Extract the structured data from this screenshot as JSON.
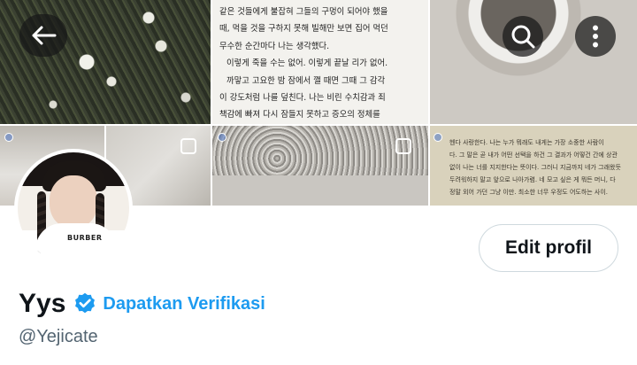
{
  "banner": {
    "book_page_lines": [
      "같은 것들에게 불잡혀 그들의 구멍이 되어야 했을",
      "때, 먹을 것을 구하지 못해 빌해만 보면 집어 먹던",
      "무수한 순간마다 나는 생각했다.",
      "이렇게 죽을 수는 없어. 이렇게 끝날 리가 없어.",
      "까맣고 고요한 밤 잠에서 깰 때면 그때 그 감각",
      "이 강도처럼 나를 덮친다. 나는 비린 수치감과 죄",
      "책감에 빠져 다시 잠들지 못하고 증오의 정체를"
    ],
    "book_page2_lines": [
      "헨다 사랑한다. 나는 누가 뭐래도 내게는 가장 소중한 사람이",
      "다. 그 말은 곧 내가 어떤 선택을 하건 그 결과가 어떻건 간에 상관",
      "없이 나는 너를 지지한다는 뜻이다. 그러니 지금까지 네가 그래왔듯",
      "두려워하지 말고 앞으로 나아가렴. 네 모고 싶은 게 뭐든 머니, 다",
      "정말 외어 가던 그냥 이만. 최소한 너무 우정도 어도하는 사이."
    ]
  },
  "nav": {
    "back_icon": "arrow-left-icon",
    "search_icon": "search-icon",
    "more_icon": "more-vertical-icon"
  },
  "profile": {
    "avatar_logo_text": "BURBER",
    "display_name": "Yys",
    "verified_icon": "verified-badge-icon",
    "get_verified_label": "Dapatkan Verifikasi",
    "handle": "@Yejicate",
    "edit_button_label": "Edit profil"
  },
  "colors": {
    "accent": "#1d9bf0",
    "text_primary": "#0f1419",
    "text_secondary": "#536471",
    "button_border": "#cfd9de"
  }
}
